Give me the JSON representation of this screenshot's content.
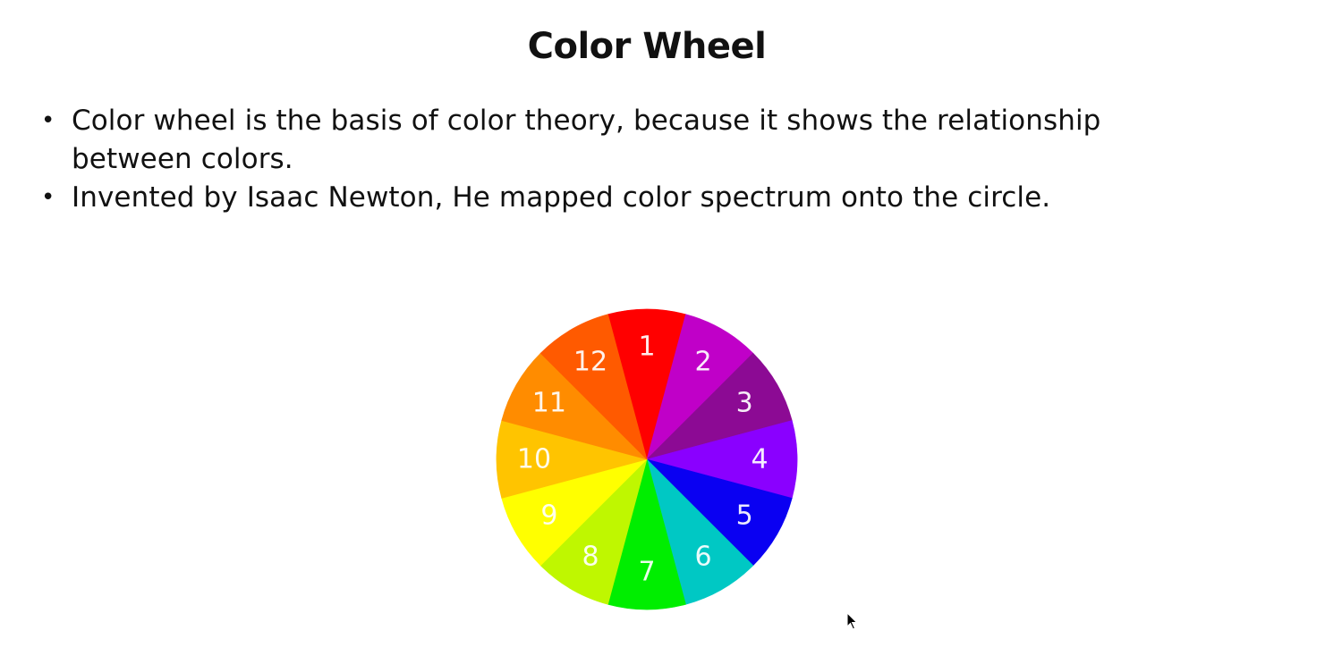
{
  "slide": {
    "title": "Color Wheel",
    "bullets": [
      "Color wheel is the basis of color theory, because it shows the relationship between colors.",
      "Invented by Isaac Newton, He mapped color spectrum onto the circle."
    ],
    "bullet_symbol": "•"
  },
  "color_wheel": {
    "segments": [
      {
        "label": "1",
        "color": "#ff0000"
      },
      {
        "label": "2",
        "color": "#c000c8"
      },
      {
        "label": "3",
        "color": "#8c0a94"
      },
      {
        "label": "4",
        "color": "#8a00ff"
      },
      {
        "label": "5",
        "color": "#0a00f2"
      },
      {
        "label": "6",
        "color": "#00c8c4"
      },
      {
        "label": "7",
        "color": "#00ee00"
      },
      {
        "label": "8",
        "color": "#bff700"
      },
      {
        "label": "9",
        "color": "#ffff00"
      },
      {
        "label": "10",
        "color": "#ffc400"
      },
      {
        "label": "11",
        "color": "#ff8c00"
      },
      {
        "label": "12",
        "color": "#ff5a00"
      }
    ]
  },
  "cursor": {
    "icon": "mouse-pointer-icon"
  }
}
